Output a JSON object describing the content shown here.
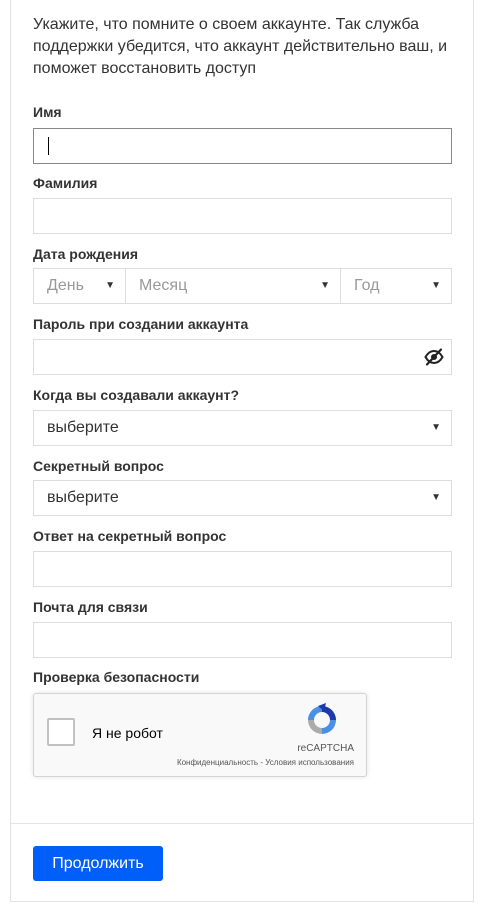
{
  "intro": "Укажите, что помните о своем аккаунте. Так служба поддержки убедится, что аккаунт действительно ваш, и поможет восстановить доступ",
  "fields": {
    "first_name": {
      "label": "Имя",
      "value": ""
    },
    "last_name": {
      "label": "Фамилия",
      "value": ""
    },
    "birth_date": {
      "label": "Дата рождения",
      "day_placeholder": "День",
      "month_placeholder": "Месяц",
      "year_placeholder": "Год"
    },
    "password": {
      "label": "Пароль при создании аккаунта",
      "value": "",
      "toggle_icon": "eye-slash-icon"
    },
    "created_when": {
      "label": "Когда вы создавали аккаунт?",
      "selected": "выберите"
    },
    "secret_question": {
      "label": "Секретный вопрос",
      "selected": "выберите"
    },
    "secret_answer": {
      "label": "Ответ на секретный вопрос",
      "value": ""
    },
    "contact_email": {
      "label": "Почта для связи",
      "value": ""
    }
  },
  "security": {
    "label": "Проверка безопасности",
    "captcha_label": "Я не робот",
    "captcha_brand": "reCAPTCHA",
    "privacy_link": "Конфиденциальность",
    "separator": " - ",
    "terms_link": "Условия использования"
  },
  "submit_label": "Продолжить",
  "colors": {
    "primary_button": "#005ff9",
    "text": "#333333",
    "border": "#dddddd"
  }
}
